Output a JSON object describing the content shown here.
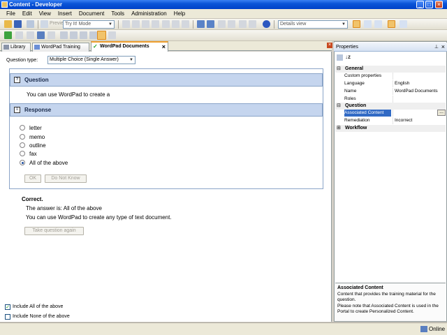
{
  "window": {
    "title": "Content - Developer",
    "minimize": "_",
    "maximize": "□",
    "close": "×"
  },
  "menu": [
    "File",
    "Edit",
    "View",
    "Insert",
    "Document",
    "Tools",
    "Administration",
    "Help"
  ],
  "toolbar": {
    "preview_label": "Preview",
    "mode_value": "Try It! Mode",
    "view_value": "Details view"
  },
  "tabs": [
    {
      "label": "Library",
      "icon": "library-icon"
    },
    {
      "label": "WordPad Training",
      "icon": "document-icon"
    },
    {
      "label": "WordPad Documents",
      "icon": "question-icon",
      "close": "×"
    }
  ],
  "question_type": {
    "label": "Question type:",
    "value": "Multiple Choice (Single Answer)"
  },
  "question": {
    "heading": "Question",
    "text": "You can use WordPad to create a"
  },
  "response": {
    "heading": "Response",
    "options": [
      "letter",
      "memo",
      "outline",
      "fax",
      "All of the above"
    ],
    "selected_index": 4,
    "ok_label": "OK",
    "dnk_label": "Do Not Know"
  },
  "feedback": {
    "title": "Correct.",
    "answer": "The answer is: All of the above",
    "explanation": "You can use WordPad to create any type of text document.",
    "retake_label": "Take question again"
  },
  "options_checks": [
    {
      "label": "Include All of the above",
      "checked": true
    },
    {
      "label": "Include None of the above",
      "checked": false
    }
  ],
  "properties": {
    "title": "Properties",
    "pin": "⊥",
    "close": "×",
    "categories": [
      {
        "name": "General",
        "rows": [
          {
            "key": "Custom properties",
            "value": ""
          },
          {
            "key": "Language",
            "value": "English"
          },
          {
            "key": "Name",
            "value": "WordPad Documents"
          },
          {
            "key": "Roles",
            "value": ""
          }
        ]
      },
      {
        "name": "Question",
        "rows": [
          {
            "key": "Associated Content",
            "value": "",
            "button": "..."
          },
          {
            "key": "Remediation",
            "value": "Incorrect"
          }
        ]
      },
      {
        "name": "Workflow",
        "rows": []
      }
    ],
    "description_title": "Associated Content",
    "description_text": "Content that provides the training material for the question.\nPlease note that Associated Content is used in the Portal to create Personalized Content."
  },
  "status": {
    "text": "Online"
  },
  "colors": {
    "title_bar": "#0a55d8",
    "section_header": "#c5d5ee",
    "selection": "#316ac5"
  }
}
